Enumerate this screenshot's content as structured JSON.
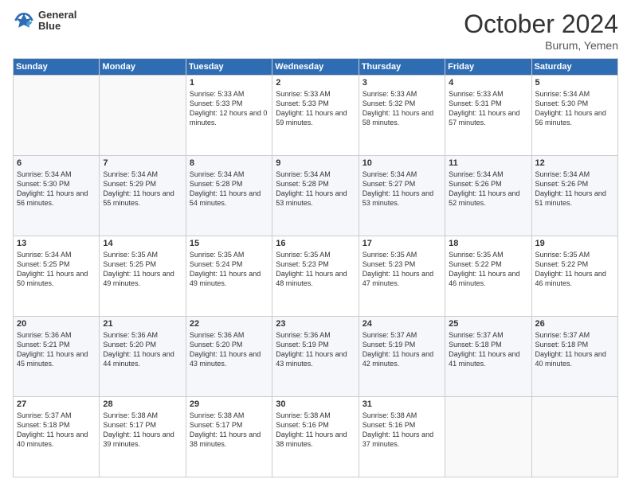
{
  "logo": {
    "line1": "General",
    "line2": "Blue"
  },
  "header": {
    "month": "October 2024",
    "location": "Burum, Yemen"
  },
  "weekdays": [
    "Sunday",
    "Monday",
    "Tuesday",
    "Wednesday",
    "Thursday",
    "Friday",
    "Saturday"
  ],
  "weeks": [
    [
      {
        "day": "",
        "sunrise": "",
        "sunset": "",
        "daylight": ""
      },
      {
        "day": "",
        "sunrise": "",
        "sunset": "",
        "daylight": ""
      },
      {
        "day": "1",
        "sunrise": "Sunrise: 5:33 AM",
        "sunset": "Sunset: 5:33 PM",
        "daylight": "Daylight: 12 hours and 0 minutes."
      },
      {
        "day": "2",
        "sunrise": "Sunrise: 5:33 AM",
        "sunset": "Sunset: 5:33 PM",
        "daylight": "Daylight: 11 hours and 59 minutes."
      },
      {
        "day": "3",
        "sunrise": "Sunrise: 5:33 AM",
        "sunset": "Sunset: 5:32 PM",
        "daylight": "Daylight: 11 hours and 58 minutes."
      },
      {
        "day": "4",
        "sunrise": "Sunrise: 5:33 AM",
        "sunset": "Sunset: 5:31 PM",
        "daylight": "Daylight: 11 hours and 57 minutes."
      },
      {
        "day": "5",
        "sunrise": "Sunrise: 5:34 AM",
        "sunset": "Sunset: 5:30 PM",
        "daylight": "Daylight: 11 hours and 56 minutes."
      }
    ],
    [
      {
        "day": "6",
        "sunrise": "Sunrise: 5:34 AM",
        "sunset": "Sunset: 5:30 PM",
        "daylight": "Daylight: 11 hours and 56 minutes."
      },
      {
        "day": "7",
        "sunrise": "Sunrise: 5:34 AM",
        "sunset": "Sunset: 5:29 PM",
        "daylight": "Daylight: 11 hours and 55 minutes."
      },
      {
        "day": "8",
        "sunrise": "Sunrise: 5:34 AM",
        "sunset": "Sunset: 5:28 PM",
        "daylight": "Daylight: 11 hours and 54 minutes."
      },
      {
        "day": "9",
        "sunrise": "Sunrise: 5:34 AM",
        "sunset": "Sunset: 5:28 PM",
        "daylight": "Daylight: 11 hours and 53 minutes."
      },
      {
        "day": "10",
        "sunrise": "Sunrise: 5:34 AM",
        "sunset": "Sunset: 5:27 PM",
        "daylight": "Daylight: 11 hours and 53 minutes."
      },
      {
        "day": "11",
        "sunrise": "Sunrise: 5:34 AM",
        "sunset": "Sunset: 5:26 PM",
        "daylight": "Daylight: 11 hours and 52 minutes."
      },
      {
        "day": "12",
        "sunrise": "Sunrise: 5:34 AM",
        "sunset": "Sunset: 5:26 PM",
        "daylight": "Daylight: 11 hours and 51 minutes."
      }
    ],
    [
      {
        "day": "13",
        "sunrise": "Sunrise: 5:34 AM",
        "sunset": "Sunset: 5:25 PM",
        "daylight": "Daylight: 11 hours and 50 minutes."
      },
      {
        "day": "14",
        "sunrise": "Sunrise: 5:35 AM",
        "sunset": "Sunset: 5:25 PM",
        "daylight": "Daylight: 11 hours and 49 minutes."
      },
      {
        "day": "15",
        "sunrise": "Sunrise: 5:35 AM",
        "sunset": "Sunset: 5:24 PM",
        "daylight": "Daylight: 11 hours and 49 minutes."
      },
      {
        "day": "16",
        "sunrise": "Sunrise: 5:35 AM",
        "sunset": "Sunset: 5:23 PM",
        "daylight": "Daylight: 11 hours and 48 minutes."
      },
      {
        "day": "17",
        "sunrise": "Sunrise: 5:35 AM",
        "sunset": "Sunset: 5:23 PM",
        "daylight": "Daylight: 11 hours and 47 minutes."
      },
      {
        "day": "18",
        "sunrise": "Sunrise: 5:35 AM",
        "sunset": "Sunset: 5:22 PM",
        "daylight": "Daylight: 11 hours and 46 minutes."
      },
      {
        "day": "19",
        "sunrise": "Sunrise: 5:35 AM",
        "sunset": "Sunset: 5:22 PM",
        "daylight": "Daylight: 11 hours and 46 minutes."
      }
    ],
    [
      {
        "day": "20",
        "sunrise": "Sunrise: 5:36 AM",
        "sunset": "Sunset: 5:21 PM",
        "daylight": "Daylight: 11 hours and 45 minutes."
      },
      {
        "day": "21",
        "sunrise": "Sunrise: 5:36 AM",
        "sunset": "Sunset: 5:20 PM",
        "daylight": "Daylight: 11 hours and 44 minutes."
      },
      {
        "day": "22",
        "sunrise": "Sunrise: 5:36 AM",
        "sunset": "Sunset: 5:20 PM",
        "daylight": "Daylight: 11 hours and 43 minutes."
      },
      {
        "day": "23",
        "sunrise": "Sunrise: 5:36 AM",
        "sunset": "Sunset: 5:19 PM",
        "daylight": "Daylight: 11 hours and 43 minutes."
      },
      {
        "day": "24",
        "sunrise": "Sunrise: 5:37 AM",
        "sunset": "Sunset: 5:19 PM",
        "daylight": "Daylight: 11 hours and 42 minutes."
      },
      {
        "day": "25",
        "sunrise": "Sunrise: 5:37 AM",
        "sunset": "Sunset: 5:18 PM",
        "daylight": "Daylight: 11 hours and 41 minutes."
      },
      {
        "day": "26",
        "sunrise": "Sunrise: 5:37 AM",
        "sunset": "Sunset: 5:18 PM",
        "daylight": "Daylight: 11 hours and 40 minutes."
      }
    ],
    [
      {
        "day": "27",
        "sunrise": "Sunrise: 5:37 AM",
        "sunset": "Sunset: 5:18 PM",
        "daylight": "Daylight: 11 hours and 40 minutes."
      },
      {
        "day": "28",
        "sunrise": "Sunrise: 5:38 AM",
        "sunset": "Sunset: 5:17 PM",
        "daylight": "Daylight: 11 hours and 39 minutes."
      },
      {
        "day": "29",
        "sunrise": "Sunrise: 5:38 AM",
        "sunset": "Sunset: 5:17 PM",
        "daylight": "Daylight: 11 hours and 38 minutes."
      },
      {
        "day": "30",
        "sunrise": "Sunrise: 5:38 AM",
        "sunset": "Sunset: 5:16 PM",
        "daylight": "Daylight: 11 hours and 38 minutes."
      },
      {
        "day": "31",
        "sunrise": "Sunrise: 5:38 AM",
        "sunset": "Sunset: 5:16 PM",
        "daylight": "Daylight: 11 hours and 37 minutes."
      },
      {
        "day": "",
        "sunrise": "",
        "sunset": "",
        "daylight": ""
      },
      {
        "day": "",
        "sunrise": "",
        "sunset": "",
        "daylight": ""
      }
    ]
  ]
}
